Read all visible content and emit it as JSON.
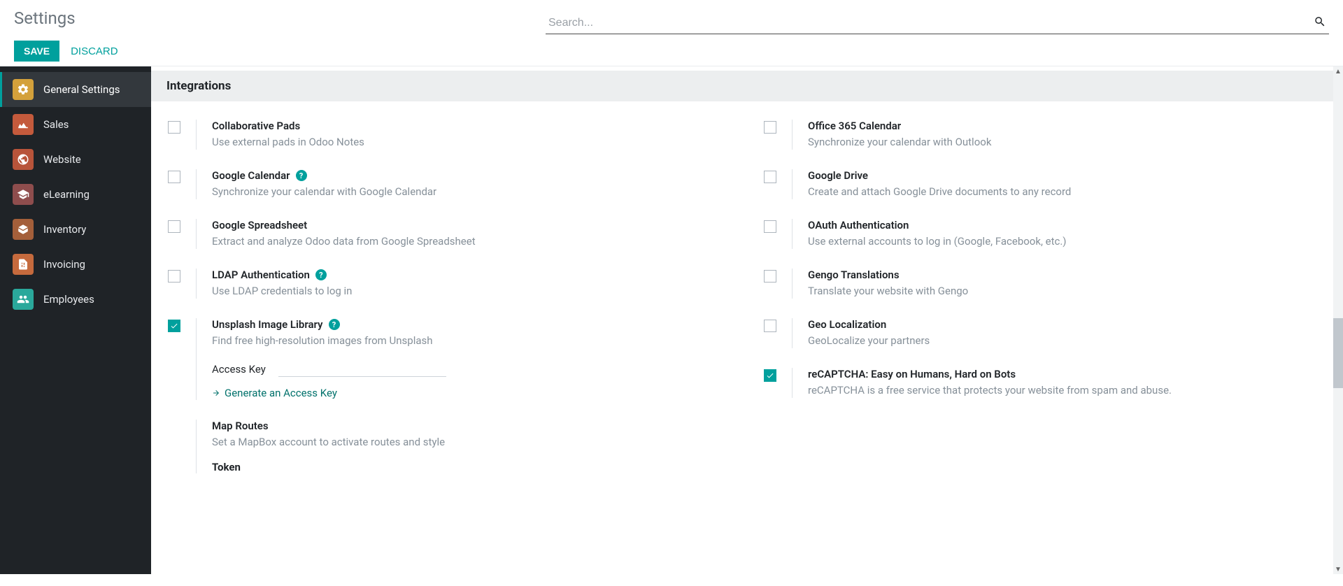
{
  "header": {
    "title": "Settings",
    "save_label": "SAVE",
    "discard_label": "DISCARD",
    "search_placeholder": "Search..."
  },
  "sidebar": {
    "items": [
      {
        "label": "General Settings",
        "active": true,
        "bg": "#d4a13b"
      },
      {
        "label": "Sales",
        "active": false,
        "bg": "#c45a3c"
      },
      {
        "label": "Website",
        "active": false,
        "bg": "#b8543a"
      },
      {
        "label": "eLearning",
        "active": false,
        "bg": "#8e4d4d"
      },
      {
        "label": "Inventory",
        "active": false,
        "bg": "#a45f3a"
      },
      {
        "label": "Invoicing",
        "active": false,
        "bg": "#c56a3d"
      },
      {
        "label": "Employees",
        "active": false,
        "bg": "#2aa89b"
      }
    ]
  },
  "section": {
    "title": "Integrations"
  },
  "left": [
    {
      "title": "Collaborative Pads",
      "desc": "Use external pads in Odoo Notes",
      "checked": false,
      "help": false
    },
    {
      "title": "Google Calendar",
      "desc": "Synchronize your calendar with Google Calendar",
      "checked": false,
      "help": true
    },
    {
      "title": "Google Spreadsheet",
      "desc": "Extract and analyze Odoo data from Google Spreadsheet",
      "checked": false,
      "help": false
    },
    {
      "title": "LDAP Authentication",
      "desc": "Use LDAP credentials to log in",
      "checked": false,
      "help": true
    },
    {
      "title": "Unsplash Image Library",
      "desc": "Find free high-resolution images from Unsplash",
      "checked": true,
      "help": true,
      "field_label": "Access Key",
      "link": "Generate an Access Key"
    },
    {
      "title": "Map Routes",
      "desc": "Set a MapBox account to activate routes and style",
      "checked": null,
      "help": false,
      "sub_label": "Token"
    }
  ],
  "right": [
    {
      "title": "Office 365 Calendar",
      "desc": "Synchronize your calendar with Outlook",
      "checked": false,
      "help": false
    },
    {
      "title": "Google Drive",
      "desc": "Create and attach Google Drive documents to any record",
      "checked": false,
      "help": false
    },
    {
      "title": "OAuth Authentication",
      "desc": "Use external accounts to log in (Google, Facebook, etc.)",
      "checked": false,
      "help": false
    },
    {
      "title": "Gengo Translations",
      "desc": "Translate your website with Gengo",
      "checked": false,
      "help": false
    },
    {
      "title": "Geo Localization",
      "desc": "GeoLocalize your partners",
      "checked": false,
      "help": false
    },
    {
      "title": "reCAPTCHA: Easy on Humans, Hard on Bots",
      "desc": "reCAPTCHA is a free service that protects your website from spam and abuse.",
      "checked": true,
      "help": false
    }
  ]
}
